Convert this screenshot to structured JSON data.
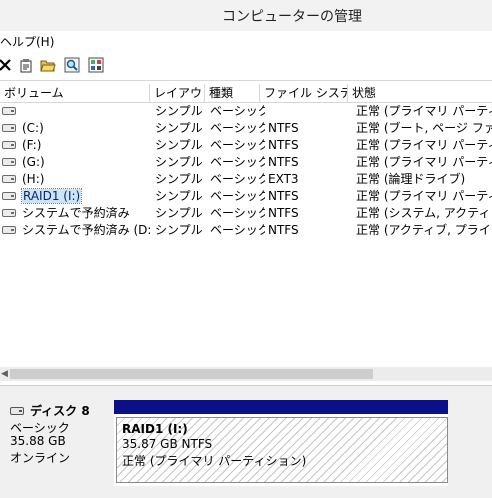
{
  "window": {
    "title": "コンピューターの管理"
  },
  "menubar": {
    "items": [
      {
        "label": "ヘルプ(H)"
      }
    ]
  },
  "toolbar": {
    "buttons": [
      {
        "icon": "delete-icon"
      },
      {
        "icon": "properties-icon"
      },
      {
        "icon": "open-folder-icon"
      },
      {
        "icon": "search-icon"
      },
      {
        "icon": "disk-view-icon"
      }
    ]
  },
  "table": {
    "columns": [
      "ボリューム",
      "レイアウト",
      "種類",
      "ファイル システム",
      "状態"
    ],
    "rows": [
      {
        "volume": "",
        "layout": "シンプル",
        "type": "ベーシック",
        "fs": "",
        "status": "正常 (プライマリ パーティション)"
      },
      {
        "volume": "(C:)",
        "layout": "シンプル",
        "type": "ベーシック",
        "fs": "NTFS",
        "status": "正常 (ブート, ページ ファイル"
      },
      {
        "volume": "(F:)",
        "layout": "シンプル",
        "type": "ベーシック",
        "fs": "NTFS",
        "status": "正常 (プライマリ パーティション)"
      },
      {
        "volume": "(G:)",
        "layout": "シンプル",
        "type": "ベーシック",
        "fs": "NTFS",
        "status": "正常 (プライマリ パーティション)"
      },
      {
        "volume": "(H:)",
        "layout": "シンプル",
        "type": "ベーシック",
        "fs": "EXT3",
        "status": "正常 (論理ドライブ)"
      },
      {
        "volume": "RAID1 (I:)",
        "layout": "シンプル",
        "type": "ベーシック",
        "fs": "NTFS",
        "status": "正常 (プライマリ パーティション)",
        "selected": true
      },
      {
        "volume": "システムで予約済み",
        "layout": "シンプル",
        "type": "ベーシック",
        "fs": "NTFS",
        "status": "正常 (システム, アクティブ, プ"
      },
      {
        "volume": "システムで予約済み (D:)",
        "layout": "シンプル",
        "type": "ベーシック",
        "fs": "NTFS",
        "status": "正常 (アクティブ, プライマリ パ"
      }
    ]
  },
  "disk": {
    "name": "ディスク 8",
    "kind": "ベーシック",
    "size": "35.88 GB",
    "state": "オンライン",
    "partition": {
      "label": "RAID1  (I:)",
      "size_fs": "35.87 GB NTFS",
      "status": "正常 (プライマリ パーティション)"
    }
  },
  "colors": {
    "partition_bar": "#0a0f8a",
    "selection": "#cce4f7"
  }
}
